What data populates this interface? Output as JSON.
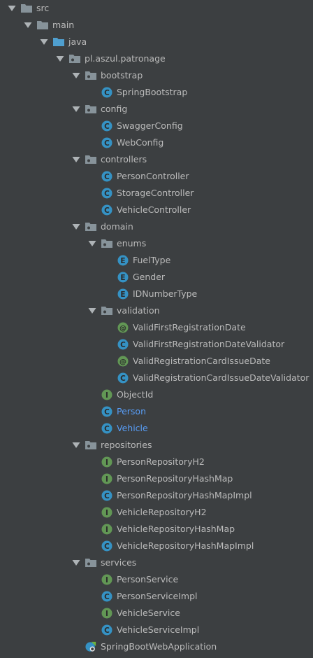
{
  "tree": {
    "nodes": [
      {
        "label": "src",
        "depth": 0,
        "kind": "folder",
        "expanded": true,
        "icon": "folder-icon"
      },
      {
        "label": "main",
        "depth": 1,
        "kind": "folder",
        "expanded": true,
        "icon": "folder-icon"
      },
      {
        "label": "java",
        "depth": 2,
        "kind": "source-folder",
        "expanded": true,
        "icon": "source-root-folder-icon"
      },
      {
        "label": "pl.aszul.patronage",
        "depth": 3,
        "kind": "package",
        "expanded": true,
        "icon": "package-icon"
      },
      {
        "label": "bootstrap",
        "depth": 4,
        "kind": "package",
        "expanded": true,
        "icon": "package-icon"
      },
      {
        "label": "SpringBootstrap",
        "depth": 5,
        "kind": "class",
        "icon": "class-icon"
      },
      {
        "label": "config",
        "depth": 4,
        "kind": "package",
        "expanded": true,
        "icon": "package-icon"
      },
      {
        "label": "SwaggerConfig",
        "depth": 5,
        "kind": "class",
        "icon": "class-icon"
      },
      {
        "label": "WebConfig",
        "depth": 5,
        "kind": "class",
        "icon": "class-icon"
      },
      {
        "label": "controllers",
        "depth": 4,
        "kind": "package",
        "expanded": true,
        "icon": "package-icon"
      },
      {
        "label": "PersonController",
        "depth": 5,
        "kind": "class",
        "icon": "class-icon"
      },
      {
        "label": "StorageController",
        "depth": 5,
        "kind": "class",
        "icon": "class-icon"
      },
      {
        "label": "VehicleController",
        "depth": 5,
        "kind": "class",
        "icon": "class-icon"
      },
      {
        "label": "domain",
        "depth": 4,
        "kind": "package",
        "expanded": true,
        "icon": "package-icon"
      },
      {
        "label": "enums",
        "depth": 5,
        "kind": "package",
        "expanded": true,
        "icon": "package-icon"
      },
      {
        "label": "FuelType",
        "depth": 6,
        "kind": "enum",
        "icon": "enum-icon"
      },
      {
        "label": "Gender",
        "depth": 6,
        "kind": "enum",
        "icon": "enum-icon"
      },
      {
        "label": "IDNumberType",
        "depth": 6,
        "kind": "enum",
        "icon": "enum-icon"
      },
      {
        "label": "validation",
        "depth": 5,
        "kind": "package",
        "expanded": true,
        "icon": "package-icon"
      },
      {
        "label": "ValidFirstRegistrationDate",
        "depth": 6,
        "kind": "annotation",
        "icon": "annotation-icon"
      },
      {
        "label": "ValidFirstRegistrationDateValidator",
        "depth": 6,
        "kind": "class",
        "icon": "class-icon"
      },
      {
        "label": "ValidRegistrationCardIssueDate",
        "depth": 6,
        "kind": "annotation",
        "icon": "annotation-icon"
      },
      {
        "label": "ValidRegistrationCardIssueDateValidator",
        "depth": 6,
        "kind": "class",
        "icon": "class-icon"
      },
      {
        "label": "ObjectId",
        "depth": 5,
        "kind": "interface",
        "icon": "interface-icon"
      },
      {
        "label": "Person",
        "depth": 5,
        "kind": "class",
        "icon": "class-icon",
        "modified": true
      },
      {
        "label": "Vehicle",
        "depth": 5,
        "kind": "class",
        "icon": "class-icon",
        "modified": true
      },
      {
        "label": "repositories",
        "depth": 4,
        "kind": "package",
        "expanded": true,
        "icon": "package-icon"
      },
      {
        "label": "PersonRepositoryH2",
        "depth": 5,
        "kind": "interface",
        "icon": "interface-icon"
      },
      {
        "label": "PersonRepositoryHashMap",
        "depth": 5,
        "kind": "interface",
        "icon": "interface-icon"
      },
      {
        "label": "PersonRepositoryHashMapImpl",
        "depth": 5,
        "kind": "class",
        "icon": "class-icon"
      },
      {
        "label": "VehicleRepositoryH2",
        "depth": 5,
        "kind": "interface",
        "icon": "interface-icon"
      },
      {
        "label": "VehicleRepositoryHashMap",
        "depth": 5,
        "kind": "interface",
        "icon": "interface-icon"
      },
      {
        "label": "VehicleRepositoryHashMapImpl",
        "depth": 5,
        "kind": "class",
        "icon": "class-icon"
      },
      {
        "label": "services",
        "depth": 4,
        "kind": "package",
        "expanded": true,
        "icon": "package-icon"
      },
      {
        "label": "PersonService",
        "depth": 5,
        "kind": "interface",
        "icon": "interface-icon"
      },
      {
        "label": "PersonServiceImpl",
        "depth": 5,
        "kind": "class",
        "icon": "class-icon"
      },
      {
        "label": "VehicleService",
        "depth": 5,
        "kind": "interface",
        "icon": "interface-icon"
      },
      {
        "label": "VehicleServiceImpl",
        "depth": 5,
        "kind": "class",
        "icon": "class-icon"
      },
      {
        "label": "SpringBootWebApplication",
        "depth": 4,
        "kind": "spring-boot-app",
        "icon": "spring-boot-application-icon"
      }
    ]
  },
  "colors": {
    "background": "#3c3f41",
    "text": "#bbbbbb",
    "modified_text": "#589df6",
    "folder": "#87939a",
    "source_folder": "#4f9fcf",
    "class_badge": "#3592c4",
    "enum_badge": "#3592c4",
    "interface_badge": "#629755",
    "annotation_badge": "#629755",
    "arrow": "#aeb3b6"
  }
}
